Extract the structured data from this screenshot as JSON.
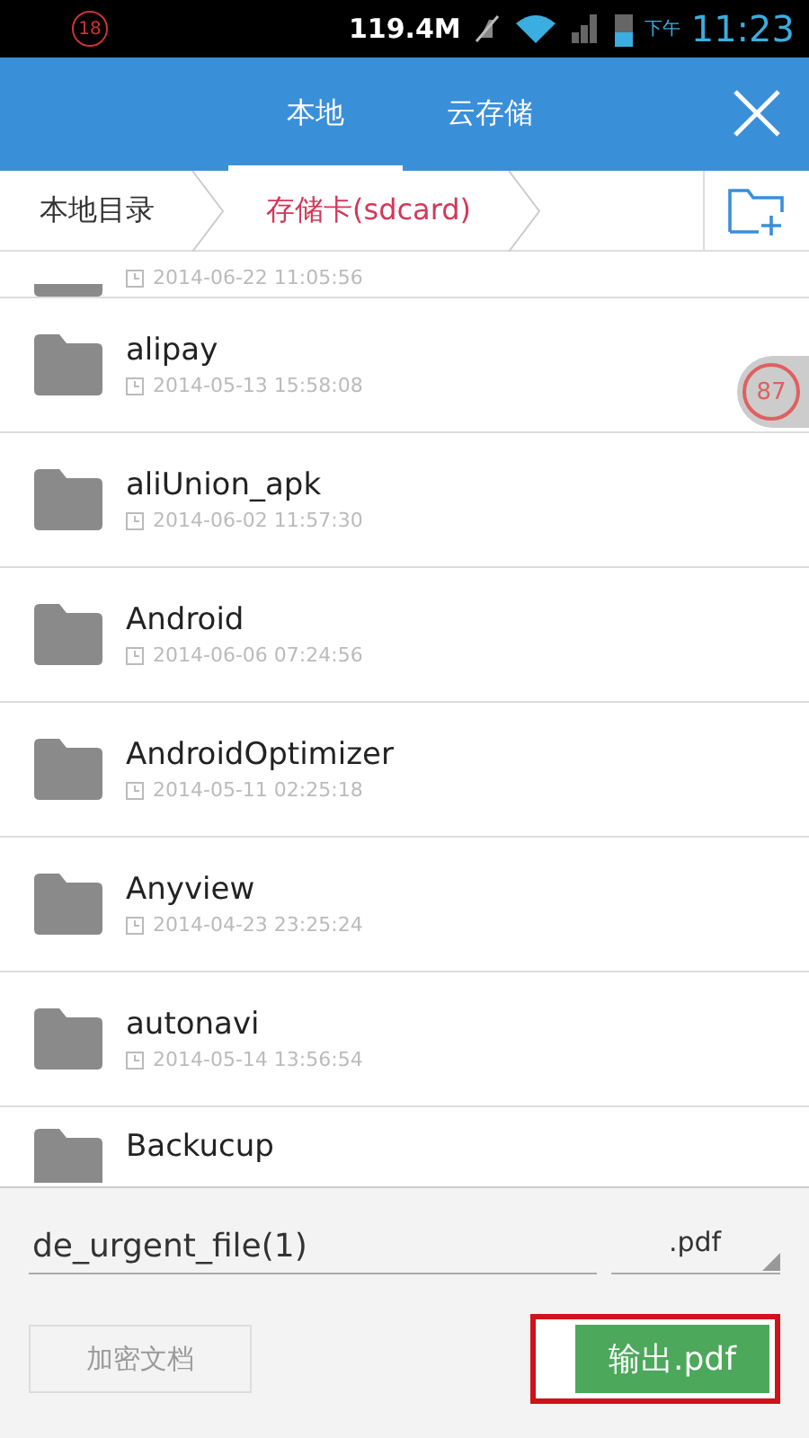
{
  "status_bar": {
    "notification_count": "18",
    "data_usage": "119.4M",
    "period": "下午",
    "time": "11:23"
  },
  "tabs": [
    {
      "label": "本地",
      "selected": true
    },
    {
      "label": "云存储",
      "selected": false
    }
  ],
  "breadcrumb": [
    {
      "label": "本地目录",
      "selected": false
    },
    {
      "label": "存储卡(sdcard)",
      "selected": true
    }
  ],
  "partial_row": {
    "date": "2014-06-22 11:05:56"
  },
  "files": [
    {
      "name": "alipay",
      "date": "2014-05-13 15:58:08"
    },
    {
      "name": "aliUnion_apk",
      "date": "2014-06-02 11:57:30"
    },
    {
      "name": "Android",
      "date": "2014-06-06 07:24:56"
    },
    {
      "name": "AndroidOptimizer",
      "date": "2014-05-11 02:25:18"
    },
    {
      "name": "Anyview",
      "date": "2014-04-23 23:25:24"
    },
    {
      "name": "autonavi",
      "date": "2014-05-14 13:56:54"
    },
    {
      "name": "Backucup"
    }
  ],
  "floating_badge": "87",
  "filename": {
    "value": "de_urgent_file(1)"
  },
  "extension": ".pdf",
  "buttons": [
    {
      "label": "加密文档",
      "disabled": true,
      "highlighted": false
    },
    {
      "label": "输出.pdf",
      "disabled": false,
      "highlighted": true
    }
  ]
}
